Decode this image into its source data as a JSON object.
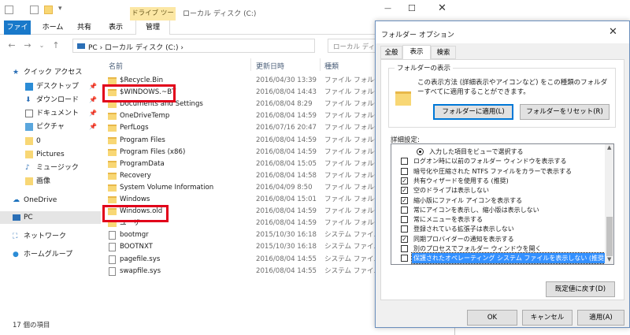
{
  "explorer": {
    "window_title": "ローカル ディスク (C:)",
    "contextual_tab": "ドライブ ツール",
    "tabs": [
      "ファイル",
      "ホーム",
      "共有",
      "表示",
      "管理"
    ],
    "breadcrumb": "PC › ローカル ディスク (C:) ›",
    "search_placeholder": "ローカル ディスク (C:)",
    "nav": [
      {
        "label": "クイック アクセス",
        "icon": "star-icon",
        "pinned": false
      },
      {
        "label": "デスクトップ",
        "icon": "desktop-icon",
        "pinned": true
      },
      {
        "label": "ダウンロード",
        "icon": "download-icon",
        "pinned": true
      },
      {
        "label": "ドキュメント",
        "icon": "document-icon",
        "pinned": true
      },
      {
        "label": "ピクチャ",
        "icon": "pictures-icon",
        "pinned": true
      },
      {
        "label": "0",
        "icon": "folder-icon",
        "pinned": false
      },
      {
        "label": "Pictures",
        "icon": "folder-icon",
        "pinned": false
      },
      {
        "label": "ミュージック",
        "icon": "music-icon",
        "pinned": false
      },
      {
        "label": "画像",
        "icon": "folder-icon",
        "pinned": false
      },
      {
        "label": "OneDrive",
        "icon": "cloud-icon",
        "pinned": false
      },
      {
        "label": "PC",
        "icon": "pc-icon",
        "pinned": false
      },
      {
        "label": "ネットワーク",
        "icon": "network-icon",
        "pinned": false
      },
      {
        "label": "ホームグループ",
        "icon": "homegroup-icon",
        "pinned": false
      }
    ],
    "columns": {
      "name": "名前",
      "date": "更新日時",
      "type": "種類"
    },
    "files": [
      {
        "name": "$Recycle.Bin",
        "date": "2016/04/30 13:39",
        "type": "ファイル フォルダー",
        "kind": "folder"
      },
      {
        "name": "$WINDOWS.~BT",
        "date": "2016/08/04 14:43",
        "type": "ファイル フォルダー",
        "kind": "folder"
      },
      {
        "name": "Documents and Settings",
        "date": "2016/08/04 8:29",
        "type": "ファイル フォルダー",
        "kind": "link"
      },
      {
        "name": "OneDriveTemp",
        "date": "2016/08/04 14:59",
        "type": "ファイル フォルダー",
        "kind": "folder"
      },
      {
        "name": "PerfLogs",
        "date": "2016/07/16 20:47",
        "type": "ファイル フォルダー",
        "kind": "folder"
      },
      {
        "name": "Program Files",
        "date": "2016/08/04 14:59",
        "type": "ファイル フォルダー",
        "kind": "folder"
      },
      {
        "name": "Program Files (x86)",
        "date": "2016/08/04 14:59",
        "type": "ファイル フォルダー",
        "kind": "folder"
      },
      {
        "name": "ProgramData",
        "date": "2016/08/04 15:05",
        "type": "ファイル フォルダー",
        "kind": "folder"
      },
      {
        "name": "Recovery",
        "date": "2016/08/04 14:58",
        "type": "ファイル フォルダー",
        "kind": "folder"
      },
      {
        "name": "System Volume Information",
        "date": "2016/04/09 8:50",
        "type": "ファイル フォルダー",
        "kind": "folder"
      },
      {
        "name": "Windows",
        "date": "2016/08/04 15:01",
        "type": "ファイル フォルダー",
        "kind": "folder"
      },
      {
        "name": "Windows.old",
        "date": "2016/08/04 14:59",
        "type": "ファイル フォルダー",
        "kind": "folder"
      },
      {
        "name": "ユーザー",
        "date": "2016/08/04 14:59",
        "type": "ファイル フォルダー",
        "kind": "folder"
      },
      {
        "name": "bootmgr",
        "date": "2015/10/30 16:18",
        "type": "システム ファイル",
        "kind": "file"
      },
      {
        "name": "BOOTNXT",
        "date": "2015/10/30 16:18",
        "type": "システム ファイル",
        "kind": "file"
      },
      {
        "name": "pagefile.sys",
        "date": "2016/08/04 14:55",
        "type": "システム ファイル",
        "kind": "file"
      },
      {
        "name": "swapfile.sys",
        "date": "2016/08/04 14:55",
        "type": "システム ファイル",
        "kind": "file"
      }
    ],
    "status": "17 個の項目"
  },
  "dialog": {
    "title": "フォルダー オプション",
    "tabs": [
      "全般",
      "表示",
      "検索"
    ],
    "view_group_label": "フォルダーの表示",
    "view_group_text": "この表示方法 (詳細表示やアイコンなど) をこの種類のフォルダーすべてに適用することができます。",
    "apply_to_folders": "フォルダーに適用(L)",
    "reset_folders": "フォルダーをリセット(R)",
    "advanced_label": "詳細設定:",
    "advanced_items": [
      {
        "label": "入力した項目をビューで選択する",
        "type": "radio",
        "checked": true
      },
      {
        "label": "ログオン時に以前のフォルダー ウィンドウを表示する",
        "type": "checkbox",
        "checked": false
      },
      {
        "label": "暗号化や圧縮された NTFS ファイルをカラーで表示する",
        "type": "checkbox",
        "checked": false
      },
      {
        "label": "共有ウィザードを使用する (推奨)",
        "type": "checkbox",
        "checked": true
      },
      {
        "label": "空のドライブは表示しない",
        "type": "checkbox",
        "checked": true
      },
      {
        "label": "縮小版にファイル アイコンを表示する",
        "type": "checkbox",
        "checked": true
      },
      {
        "label": "常にアイコンを表示し、縮小版は表示しない",
        "type": "checkbox",
        "checked": false
      },
      {
        "label": "常にメニューを表示する",
        "type": "checkbox",
        "checked": false
      },
      {
        "label": "登録されている拡張子は表示しない",
        "type": "checkbox",
        "checked": false
      },
      {
        "label": "同期プロバイダーの通知を表示する",
        "type": "checkbox",
        "checked": true
      },
      {
        "label": "別のプロセスでフォルダー ウィンドウを開く",
        "type": "checkbox",
        "checked": false
      },
      {
        "label": "保護されたオペレーティング システム ファイルを表示しない (推奨)",
        "type": "checkbox",
        "checked": false,
        "selected": true
      }
    ],
    "restore_defaults": "既定値に戻す(D)",
    "ok": "OK",
    "cancel": "キャンセル",
    "apply": "適用(A)"
  },
  "colors": {
    "accent": "#1979ca",
    "highlight_box": "#e1001a",
    "selection": "#3390ff"
  }
}
